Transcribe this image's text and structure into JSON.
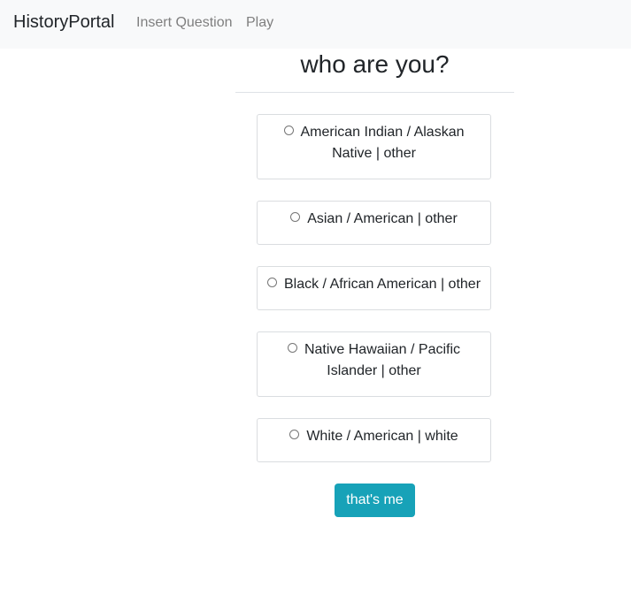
{
  "navbar": {
    "brand": "HistoryPortal",
    "links": [
      "Insert Question",
      "Play"
    ],
    "background": "#f8f9fa"
  },
  "main": {
    "title": "who are you?",
    "options": [
      {
        "label": "American Indian / Alaskan Native | other",
        "selected": false
      },
      {
        "label": "Asian / American | other",
        "selected": false
      },
      {
        "label": "Black / African American | other",
        "selected": false
      },
      {
        "label": "Native Hawaiian / Pacific Islander | other",
        "selected": false
      },
      {
        "label": "White / American | white",
        "selected": false
      }
    ],
    "submit_label": "that's me",
    "submit_color": "#17a2b8"
  }
}
